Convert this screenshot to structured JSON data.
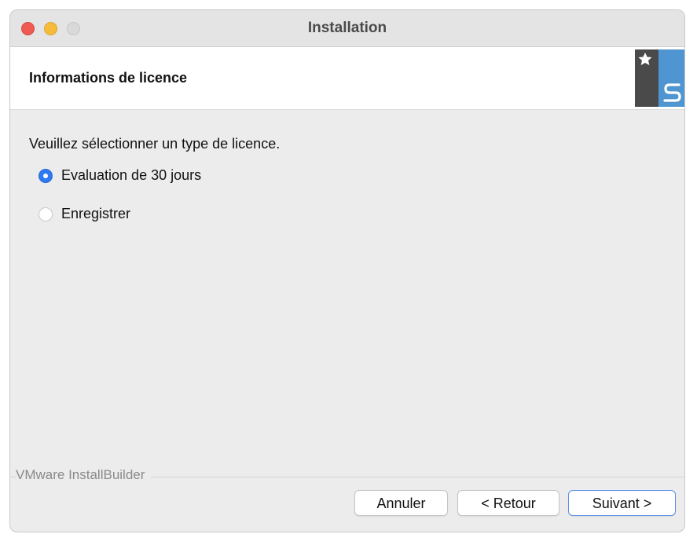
{
  "window": {
    "title": "Installation"
  },
  "header": {
    "title": "Informations de licence",
    "logo_icon": "installbuilder-logo-icon",
    "logo_colors": {
      "dark": "#4a4a4a",
      "blue": "#4f95d2"
    }
  },
  "content": {
    "instruction": "Veuillez sélectionner un type de licence.",
    "options": [
      {
        "label": "Evaluation de 30 jours",
        "selected": true
      },
      {
        "label": "Enregistrer",
        "selected": false
      }
    ]
  },
  "footer": {
    "brand": "VMware InstallBuilder",
    "buttons": {
      "cancel": "Annuler",
      "back": "< Retour",
      "next": "Suivant >"
    }
  },
  "colors": {
    "accent": "#2f7af1",
    "window_bg": "#ececec"
  }
}
